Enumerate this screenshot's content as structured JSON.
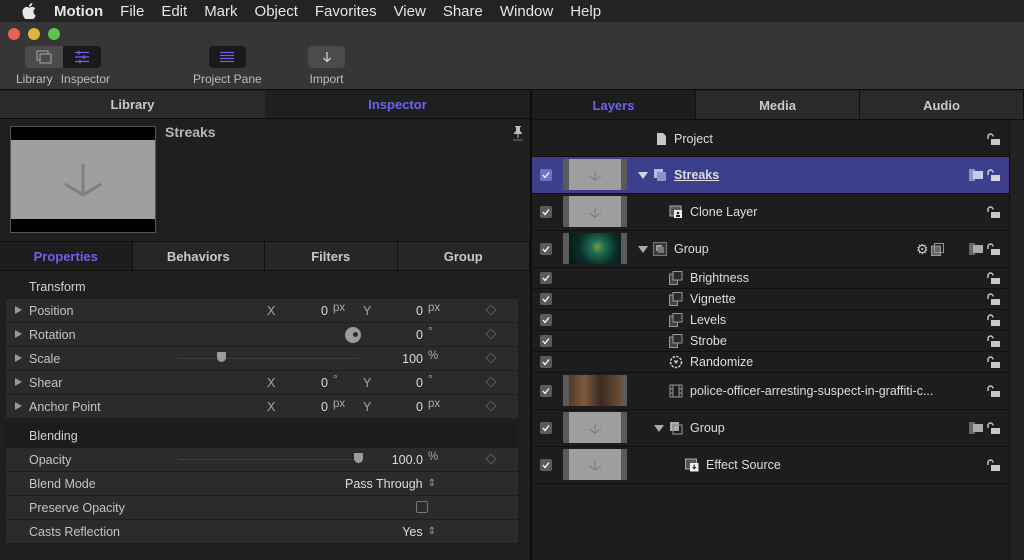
{
  "menubar": {
    "apple": "apple-logo",
    "items": [
      "Motion",
      "File",
      "Edit",
      "Mark",
      "Object",
      "Favorites",
      "View",
      "Share",
      "Window",
      "Help"
    ]
  },
  "toolbar": {
    "library_label": "Library",
    "inspector_label": "Inspector",
    "project_pane_label": "Project Pane",
    "import_label": "Import"
  },
  "left_panel": {
    "tabs": [
      "Library",
      "Inspector"
    ],
    "active_tab": "Inspector",
    "object_name": "Streaks",
    "subtabs": [
      "Properties",
      "Behaviors",
      "Filters",
      "Group"
    ],
    "active_subtab": "Properties",
    "transform": {
      "heading": "Transform",
      "position": {
        "label": "Position",
        "x_axis": "X",
        "x": "0",
        "x_unit": "px",
        "y_axis": "Y",
        "y": "0",
        "y_unit": "px"
      },
      "rotation": {
        "label": "Rotation",
        "value": "0",
        "unit": "°"
      },
      "scale": {
        "label": "Scale",
        "value": "100",
        "unit": "%",
        "slider_fraction": 0.1
      },
      "shear": {
        "label": "Shear",
        "x_axis": "X",
        "x": "0",
        "x_unit": "°",
        "y_axis": "Y",
        "y": "0",
        "y_unit": "°"
      },
      "anchor": {
        "label": "Anchor Point",
        "x_axis": "X",
        "x": "0",
        "x_unit": "px",
        "y_axis": "Y",
        "y": "0",
        "y_unit": "px"
      }
    },
    "blending": {
      "heading": "Blending",
      "opacity": {
        "label": "Opacity",
        "value": "100.0",
        "unit": "%",
        "slider_fraction": 1.0
      },
      "blend_mode": {
        "label": "Blend Mode",
        "value": "Pass Through"
      },
      "preserve_opacity": {
        "label": "Preserve Opacity",
        "checked": false
      },
      "casts_reflection": {
        "label": "Casts Reflection",
        "value": "Yes"
      }
    }
  },
  "right_panel": {
    "tabs": [
      "Layers",
      "Media",
      "Audio"
    ],
    "active_tab": "Layers",
    "layers": [
      {
        "name": "Project",
        "type": "project"
      },
      {
        "name": "Streaks",
        "type": "group",
        "selected": true,
        "checked": true
      },
      {
        "name": "Clone Layer",
        "type": "clone",
        "checked": true
      },
      {
        "name": "Group",
        "type": "group",
        "checked": true
      },
      {
        "name": "Brightness",
        "type": "filter",
        "checked": true
      },
      {
        "name": "Vignette",
        "type": "filter",
        "checked": true
      },
      {
        "name": "Levels",
        "type": "filter",
        "checked": true
      },
      {
        "name": "Strobe",
        "type": "filter",
        "checked": true
      },
      {
        "name": "Randomize",
        "type": "behavior",
        "checked": true
      },
      {
        "name": "police-officer-arresting-suspect-in-graffiti-c...",
        "type": "video",
        "checked": true
      },
      {
        "name": "Group",
        "type": "group",
        "checked": true
      },
      {
        "name": "Effect Source",
        "type": "effect-source",
        "checked": true
      }
    ]
  },
  "colors": {
    "accent": "#6b62f0",
    "selection": "#3c3f8c",
    "close": "#ec5f57",
    "minimize": "#e1b53d",
    "zoom": "#5ec24f"
  }
}
